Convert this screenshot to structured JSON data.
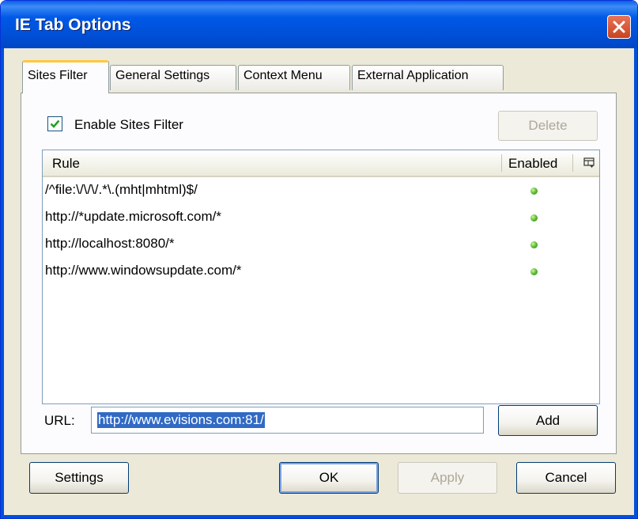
{
  "window": {
    "title": "IE Tab Options"
  },
  "tabs": [
    {
      "label": "Sites Filter",
      "active": true
    },
    {
      "label": "General Settings",
      "active": false
    },
    {
      "label": "Context Menu",
      "active": false
    },
    {
      "label": "External Application",
      "active": false
    }
  ],
  "sites_filter": {
    "enable_label": "Enable Sites Filter",
    "enabled": true,
    "delete_label": "Delete",
    "columns": {
      "rule": "Rule",
      "enabled": "Enabled"
    },
    "rows": [
      {
        "rule": "/^file:\\/\\/\\/.*\\.(mht|mhtml)$/",
        "enabled": true
      },
      {
        "rule": "http://*update.microsoft.com/*",
        "enabled": true
      },
      {
        "rule": "http://localhost:8080/*",
        "enabled": true
      },
      {
        "rule": "http://www.windowsupdate.com/*",
        "enabled": true
      }
    ],
    "url_label": "URL:",
    "url_value": "http://www.evisions.com:81/",
    "add_label": "Add"
  },
  "footer": {
    "settings_label": "Settings",
    "ok_label": "OK",
    "apply_label": "Apply",
    "cancel_label": "Cancel"
  },
  "colors": {
    "enabled_dot": "#4caf2a",
    "title_bar": "#0054e3",
    "selection": "#316ac5"
  }
}
